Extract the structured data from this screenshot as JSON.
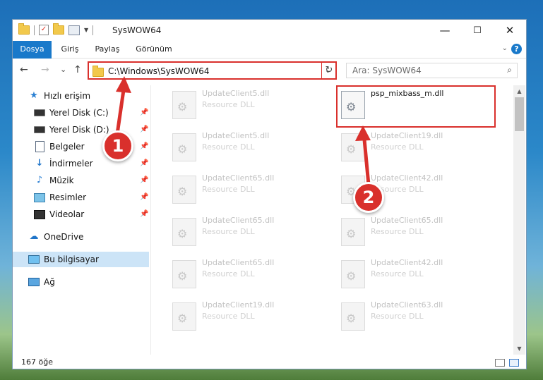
{
  "window": {
    "title": "SysWOW64",
    "controls": {
      "minimize": "—",
      "maximize": "☐",
      "close": "✕"
    }
  },
  "ribbon": {
    "tabs": [
      "Dosya",
      "Giriş",
      "Paylaş",
      "Görünüm"
    ],
    "help": "?"
  },
  "nav": {
    "back": "←",
    "forward": "→",
    "recent": "⌄",
    "up": "↑",
    "address": "C:\\Windows\\SysWOW64",
    "refresh": "↻",
    "search_placeholder": "Ara: SysWOW64"
  },
  "sidebar": {
    "quick_access": "Hızlı erişim",
    "pinned": [
      "Yerel Disk (C:)",
      "Yerel Disk (D:)",
      "Belgeler",
      "İndirmeler",
      "Müzik",
      "Resimler",
      "Videolar"
    ],
    "onedrive": "OneDrive",
    "this_pc": "Bu bilgisayar",
    "network": "Ağ"
  },
  "files": {
    "left_column": [
      {
        "name": "UpdateClient5.dll",
        "type": "Resource DLL"
      },
      {
        "name": "UpdateClient5.dll",
        "type": "Resource DLL"
      },
      {
        "name": "UpdateClient65.dll",
        "type": "Resource DLL"
      },
      {
        "name": "UpdateClient65.dll",
        "type": "Resource DLL"
      },
      {
        "name": "UpdateClient65.dll",
        "type": "Resource DLL"
      },
      {
        "name": "UpdateClient19.dll",
        "type": "Resource DLL"
      }
    ],
    "right_column": [
      {
        "name": "psp_mixbass_m.dll",
        "type": ""
      },
      {
        "name": "UpdateClient19.dll",
        "type": "Resource DLL"
      },
      {
        "name": "UpdateClient42.dll",
        "type": "Resource DLL"
      },
      {
        "name": "UpdateClient65.dll",
        "type": "Resource DLL"
      },
      {
        "name": "UpdateClient42.dll",
        "type": "Resource DLL"
      },
      {
        "name": "UpdateClient63.dll",
        "type": "Resource DLL"
      }
    ]
  },
  "status": {
    "count": "167 öğe"
  },
  "callouts": {
    "one": "1",
    "two": "2"
  },
  "colors": {
    "accent": "#1979ca",
    "highlight": "#d9302c",
    "selection": "#cce4f7"
  }
}
